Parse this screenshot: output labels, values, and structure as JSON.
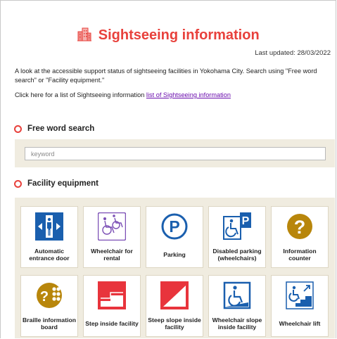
{
  "header": {
    "title": "Sightseeing information",
    "icon": "building-icon"
  },
  "last_updated": "Last updated: 28/03/2022",
  "intro": {
    "text": "A look at the accessible support status of sightseeing facilities in Yokohama City. Search using \"Free word search\" or \"Facility equipment.\"",
    "list_prefix": "Click here for a list of Sightseeing information",
    "list_link": "list of Sightseeing information"
  },
  "free_word": {
    "heading": "Free word search",
    "placeholder": "keyword",
    "value": ""
  },
  "facility": {
    "heading": "Facility equipment",
    "items": [
      {
        "label": "Automatic entrance door",
        "icon": "automatic-door-icon",
        "color": "#1a5fae"
      },
      {
        "label": "Wheelchair for rental",
        "icon": "wheelchair-rental-icon",
        "color": "#7b4fb5"
      },
      {
        "label": "Parking",
        "icon": "parking-icon",
        "color": "#1a5fae"
      },
      {
        "label": "Disabled parking (wheelchairs)",
        "icon": "disabled-parking-icon",
        "color": "#1a5fae"
      },
      {
        "label": "Information counter",
        "icon": "information-counter-icon",
        "color": "#b8860b"
      },
      {
        "label": "Braille information board",
        "icon": "braille-board-icon",
        "color": "#b8860b"
      },
      {
        "label": "Step inside facility",
        "icon": "step-icon",
        "color": "#e8343c"
      },
      {
        "label": "Steep slope inside facility",
        "icon": "steep-slope-icon",
        "color": "#e8343c"
      },
      {
        "label": "Wheelchair slope inside facility",
        "icon": "wheelchair-slope-icon",
        "color": "#1a5fae"
      },
      {
        "label": "Wheelchair lift",
        "icon": "wheelchair-lift-icon",
        "color": "#1a5fae"
      }
    ]
  },
  "colors": {
    "accent": "#e8413c",
    "panel": "#f0ece0",
    "link": "#6a0dad"
  }
}
